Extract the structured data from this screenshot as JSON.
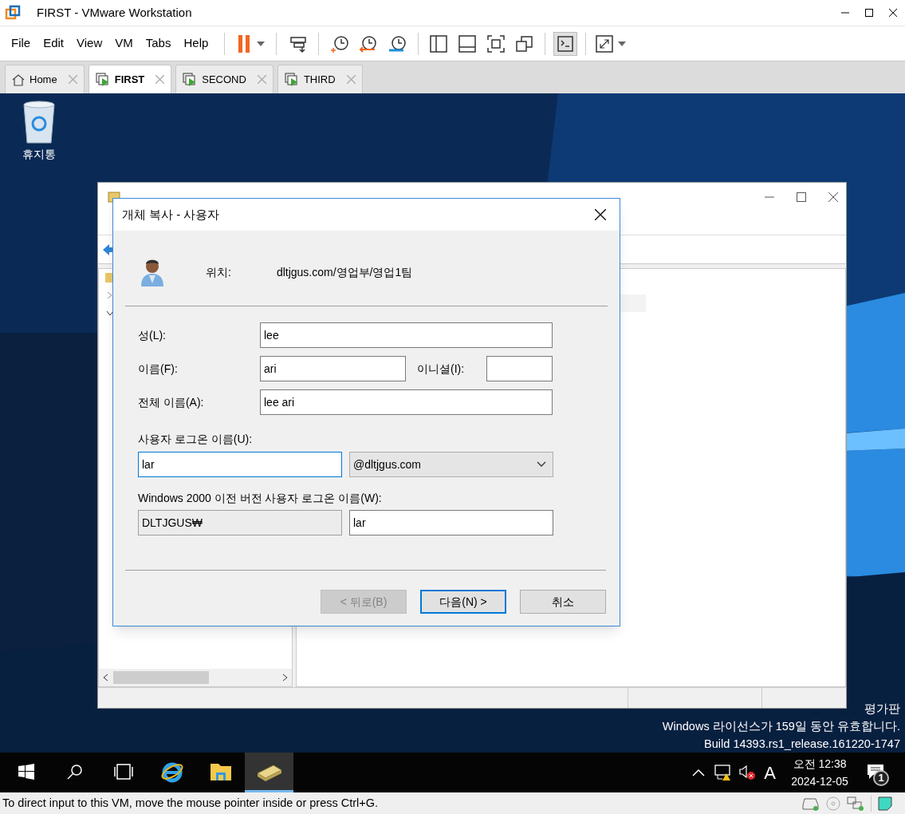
{
  "window": {
    "title": "FIRST - VMware Workstation"
  },
  "menu": [
    "File",
    "Edit",
    "View",
    "VM",
    "Tabs",
    "Help"
  ],
  "tabs": [
    {
      "label": "Home",
      "kind": "home",
      "selected": false
    },
    {
      "label": "FIRST",
      "kind": "vm",
      "selected": true
    },
    {
      "label": "SECOND",
      "kind": "vm",
      "selected": false
    },
    {
      "label": "THIRD",
      "kind": "vm",
      "selected": false
    }
  ],
  "desktop": {
    "icons": [
      {
        "label": "휴지통"
      }
    ],
    "notice": [
      "평가판",
      "Windows 라이선스가 159일 동안 유효합니다.",
      "Build 14393.rs1_release.161220-1747"
    ]
  },
  "dialog": {
    "title": "개체 복사 - 사용자",
    "location_label": "위치:",
    "location": "dltjgus.com/영업부/영업1팀",
    "last_name": {
      "label": "성(L):",
      "value": "lee"
    },
    "first_name": {
      "label": "이름(F):",
      "value": "ari"
    },
    "initials": {
      "label": "이니셜(I):"
    },
    "full_name": {
      "label": "전체 이름(A):",
      "value": "lee ari"
    },
    "logon_name": {
      "label": "사용자 로그온 이름(U):",
      "value": "lar",
      "focused": true
    },
    "domain": {
      "value": "@dltjgus.com"
    },
    "pre2000": {
      "label": "Windows 2000 이전 버전 사용자 로그온 이름(W):",
      "prefix": "DLTJGUS₩",
      "value": "lar"
    },
    "buttons": [
      {
        "label": "< 뒤로(B)",
        "disabled": true,
        "default": false
      },
      {
        "label": "다음(N) >",
        "disabled": false,
        "default": true
      },
      {
        "label": "취소",
        "disabled": false,
        "default": false
      }
    ]
  },
  "taskbar": {
    "apps": [
      {
        "kind": "start",
        "selected": false
      },
      {
        "kind": "search",
        "selected": false
      },
      {
        "kind": "taskview",
        "selected": false
      },
      {
        "kind": "browser",
        "selected": false
      },
      {
        "kind": "explorer",
        "selected": false
      },
      {
        "kind": "ad",
        "selected": true
      }
    ],
    "input_indicator": "A",
    "time": "오전 12:38",
    "date": "2024-12-05",
    "notifications": "1"
  },
  "status_bar": {
    "text": "To direct input to this VM, move the mouse pointer inside or press Ctrl+G."
  }
}
